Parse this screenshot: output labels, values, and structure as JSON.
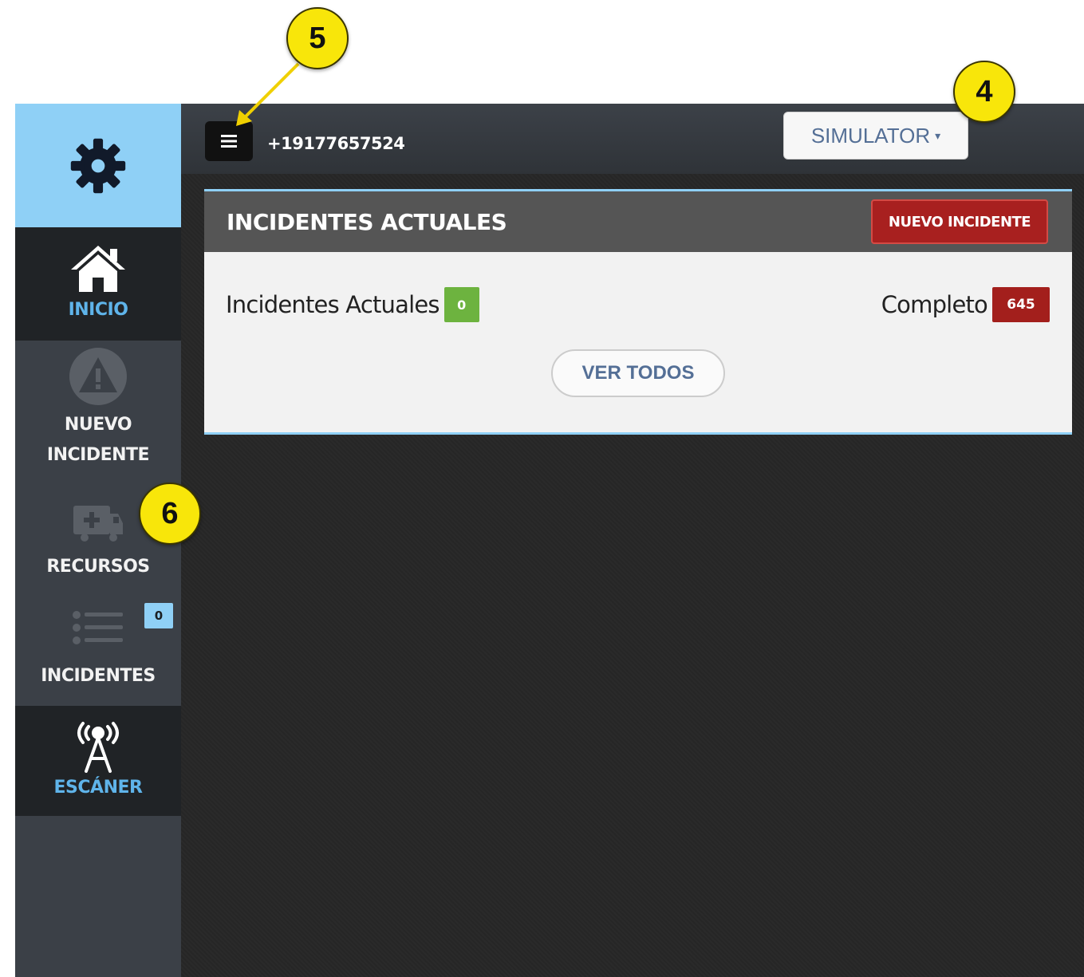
{
  "header": {
    "phone": "+19177657524",
    "simulator_label": "SIMULATOR"
  },
  "sidebar": {
    "logo_icon": "gear-icon",
    "items": [
      {
        "label": "INICIO",
        "icon": "home-icon",
        "active": true
      },
      {
        "label_line1": "NUEVO",
        "label_line2": "INCIDENTE",
        "icon": "warning-icon"
      },
      {
        "label": "RECURSOS",
        "icon": "ambulance-icon"
      },
      {
        "label": "INCIDENTES",
        "icon": "list-icon",
        "badge": "0"
      },
      {
        "label": "ESCÁNER",
        "icon": "radio-tower-icon",
        "active": true
      }
    ]
  },
  "panel": {
    "title": "INCIDENTES ACTUALES",
    "new_button": "NUEVO INCIDENTE",
    "current_label": "Incidentes Actuales",
    "current_count": "0",
    "complete_label": "Completo",
    "complete_count": "645",
    "view_all": "VER TODOS"
  },
  "callouts": [
    "5",
    "4",
    "6"
  ],
  "colors": {
    "accent": "#8fd0f6",
    "danger": "#a8201f",
    "success": "#6db33f",
    "callout": "#f8e60a"
  }
}
